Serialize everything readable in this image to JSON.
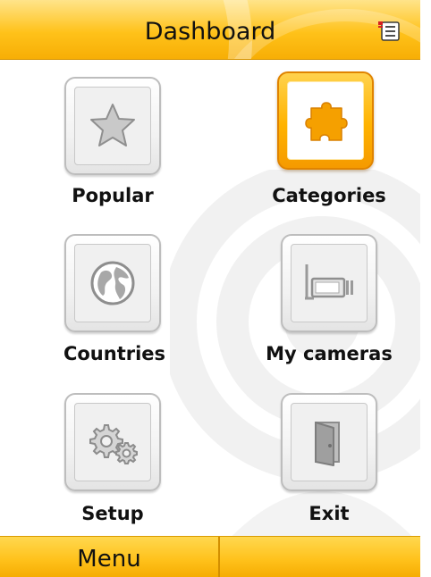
{
  "header": {
    "title": "Dashboard",
    "menu_icon": "list-menu-icon"
  },
  "grid": {
    "items": [
      {
        "label": "Popular",
        "icon": "star-icon",
        "selected": false
      },
      {
        "label": "Categories",
        "icon": "puzzle-piece-icon",
        "selected": true
      },
      {
        "label": "Countries",
        "icon": "globe-icon",
        "selected": false
      },
      {
        "label": "My cameras",
        "icon": "camera-icon",
        "selected": false
      },
      {
        "label": "Setup",
        "icon": "gears-icon",
        "selected": false
      },
      {
        "label": "Exit",
        "icon": "door-icon",
        "selected": false
      }
    ]
  },
  "softkeys": {
    "left": "Menu",
    "right": ""
  },
  "colors": {
    "accent": "#ffc21a",
    "accent_dark": "#f59a00",
    "highlight_icon": "#f5a000"
  }
}
